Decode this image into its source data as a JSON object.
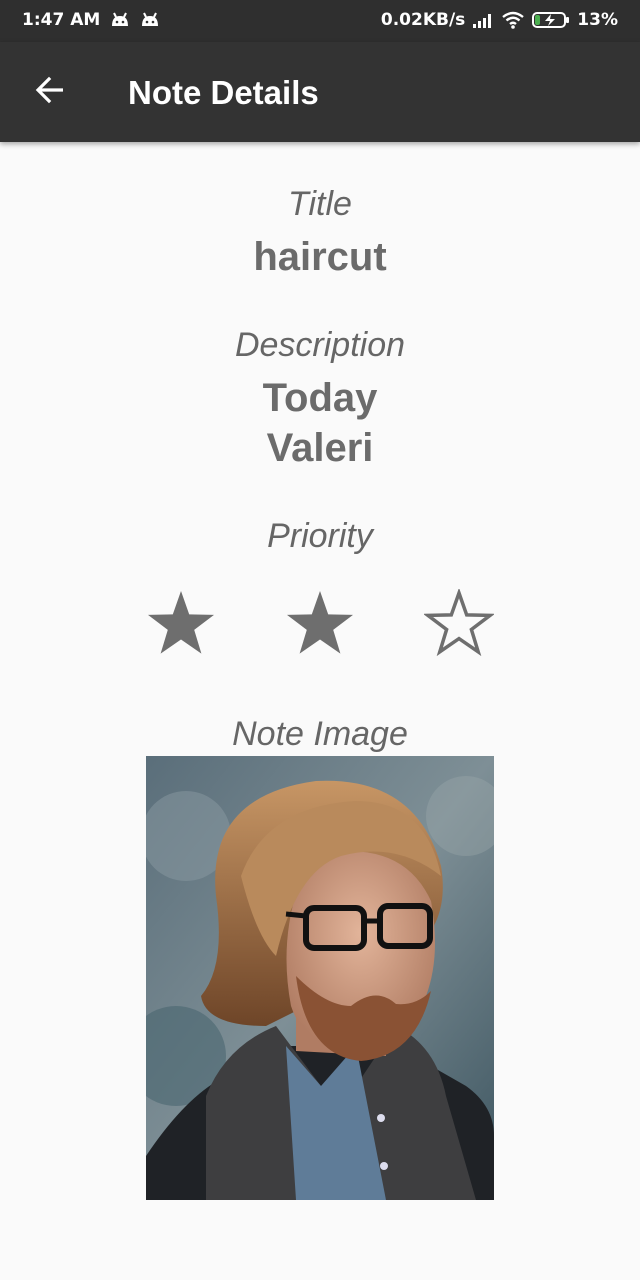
{
  "status_bar": {
    "time": "1:47 AM",
    "network_speed": "0.02KB/s",
    "battery": "13%",
    "icons": [
      "android-notification-icon",
      "android-notification-icon",
      "signal-icon",
      "wifi-icon",
      "battery-charging-icon"
    ]
  },
  "app_bar": {
    "title": "Note Details",
    "back_icon": "arrow-back-icon"
  },
  "note": {
    "title_label": "Title",
    "title_value": "haircut",
    "description_label": "Description",
    "description_line1": "Today",
    "description_line2": "Valeri",
    "priority_label": "Priority",
    "priority": {
      "filled": 2,
      "total": 3
    },
    "image_label": "Note Image"
  },
  "colors": {
    "status_bar_bg": "#2f2f2f",
    "app_bar_bg": "#333333",
    "page_bg": "#fafafa",
    "text_gray": "#6b6b6b",
    "star_gray": "#6e6e6e"
  }
}
